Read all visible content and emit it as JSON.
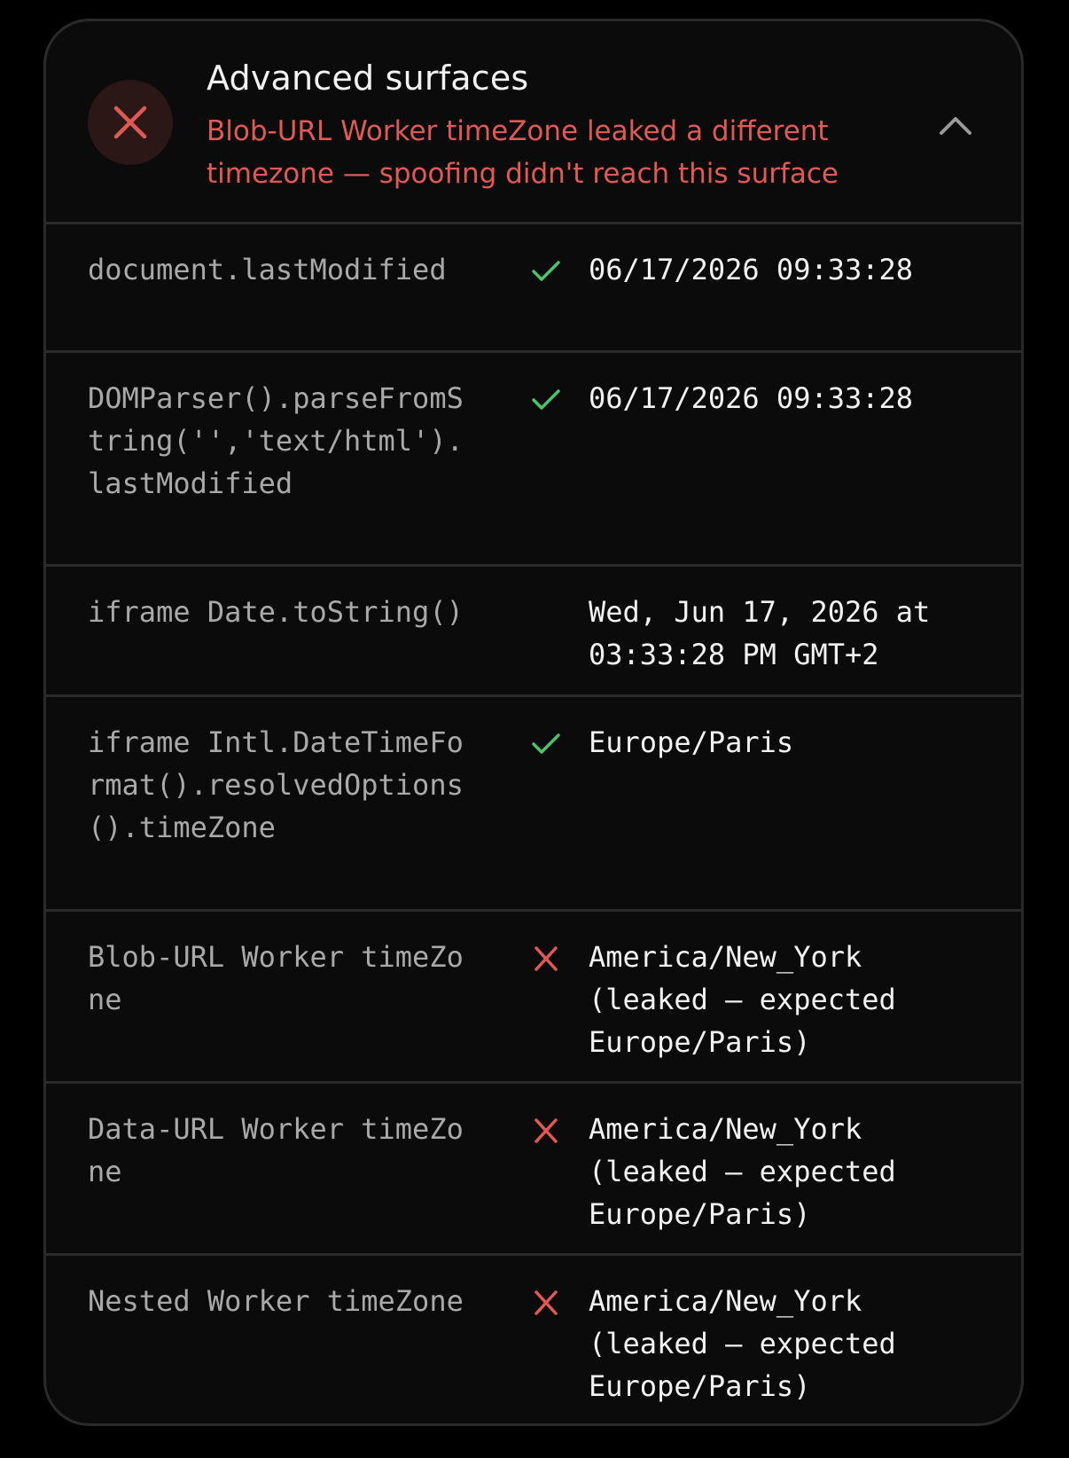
{
  "section": {
    "title": "Advanced surfaces",
    "status": "fail",
    "status_icon": "x-icon",
    "status_color": "#e05a55",
    "status_bg": "#2c1717",
    "summary": "Blob-URL Worker timeZone leaked a different timezone — spoofing didn't reach this surface",
    "toggle_icon": "chevron-up-icon",
    "expanded": true
  },
  "colors": {
    "pass": "#4cc26a",
    "fail": "#e05a55",
    "label": "#a9a9a9",
    "value": "#f2f2f2"
  },
  "rows": [
    {
      "label": "document.lastModified",
      "status": "pass",
      "icon": "check-icon",
      "value": "06/17/2026 09:33:28"
    },
    {
      "label": "DOMParser().parseFromString('','text/html').lastModified",
      "status": "pass",
      "icon": "check-icon",
      "value": "06/17/2026 09:33:28"
    },
    {
      "label": "iframe Date.toString()",
      "status": "none",
      "icon": "",
      "value": "Wed, Jun 17, 2026 at 03:33:28 PM GMT+2"
    },
    {
      "label": "iframe Intl.DateTimeFormat().resolvedOptions().timeZone",
      "status": "pass",
      "icon": "check-icon",
      "value": "Europe/Paris"
    },
    {
      "label": "Blob-URL Worker timeZone",
      "status": "fail",
      "icon": "x-icon",
      "value": "America/New_York (leaked — expected Europe/Paris)"
    },
    {
      "label": "Data-URL Worker timeZone",
      "status": "fail",
      "icon": "x-icon",
      "value": "America/New_York (leaked — expected Europe/Paris)"
    },
    {
      "label": "Nested Worker timeZone",
      "status": "fail",
      "icon": "x-icon",
      "value": "America/New_York (leaked — expected Europe/Paris)"
    }
  ]
}
